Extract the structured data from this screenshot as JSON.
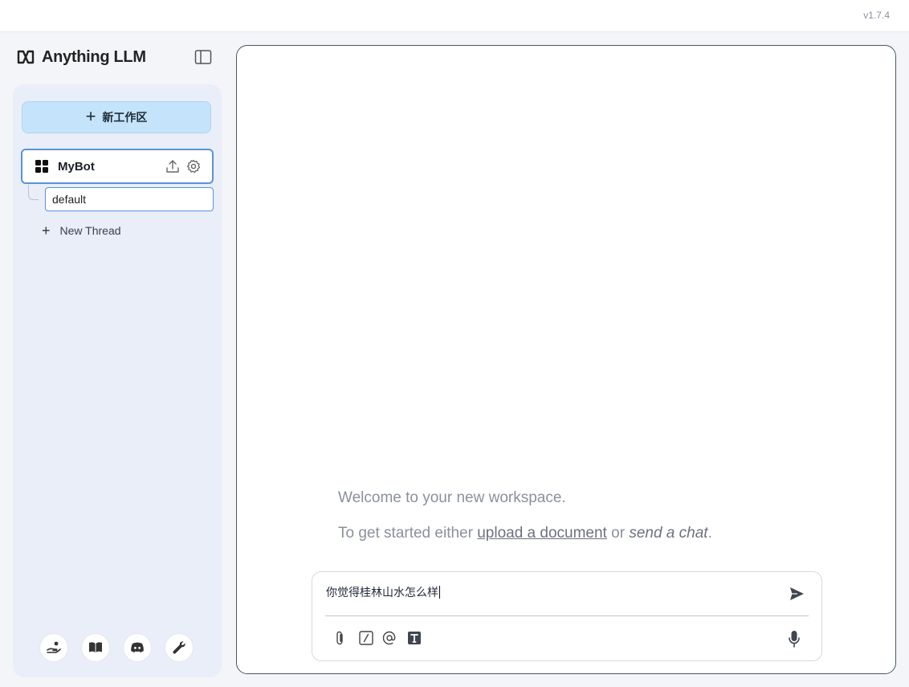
{
  "app": {
    "version": "v1.7.4",
    "brand": "Anything LLM"
  },
  "sidebar": {
    "new_workspace_label": "新工作区",
    "workspace": {
      "name": "MyBot",
      "threads": [
        {
          "name": "default"
        }
      ],
      "new_thread_label": "New Thread"
    },
    "footer_icons": [
      "community-hub-icon",
      "docs-icon",
      "discord-icon",
      "settings-wrench-icon"
    ]
  },
  "main": {
    "welcome": "Welcome to your new workspace.",
    "getstarted_prefix": "To get started either",
    "upload_link": "upload a document",
    "or_text": "or",
    "send_chat": "send a chat",
    "period": "."
  },
  "prompt": {
    "value": "你觉得桂林山水怎么样"
  },
  "colors": {
    "accent": "#c5e4fb",
    "selected_border": "#5a93d6",
    "sidebar_bg": "#e9eef8"
  }
}
